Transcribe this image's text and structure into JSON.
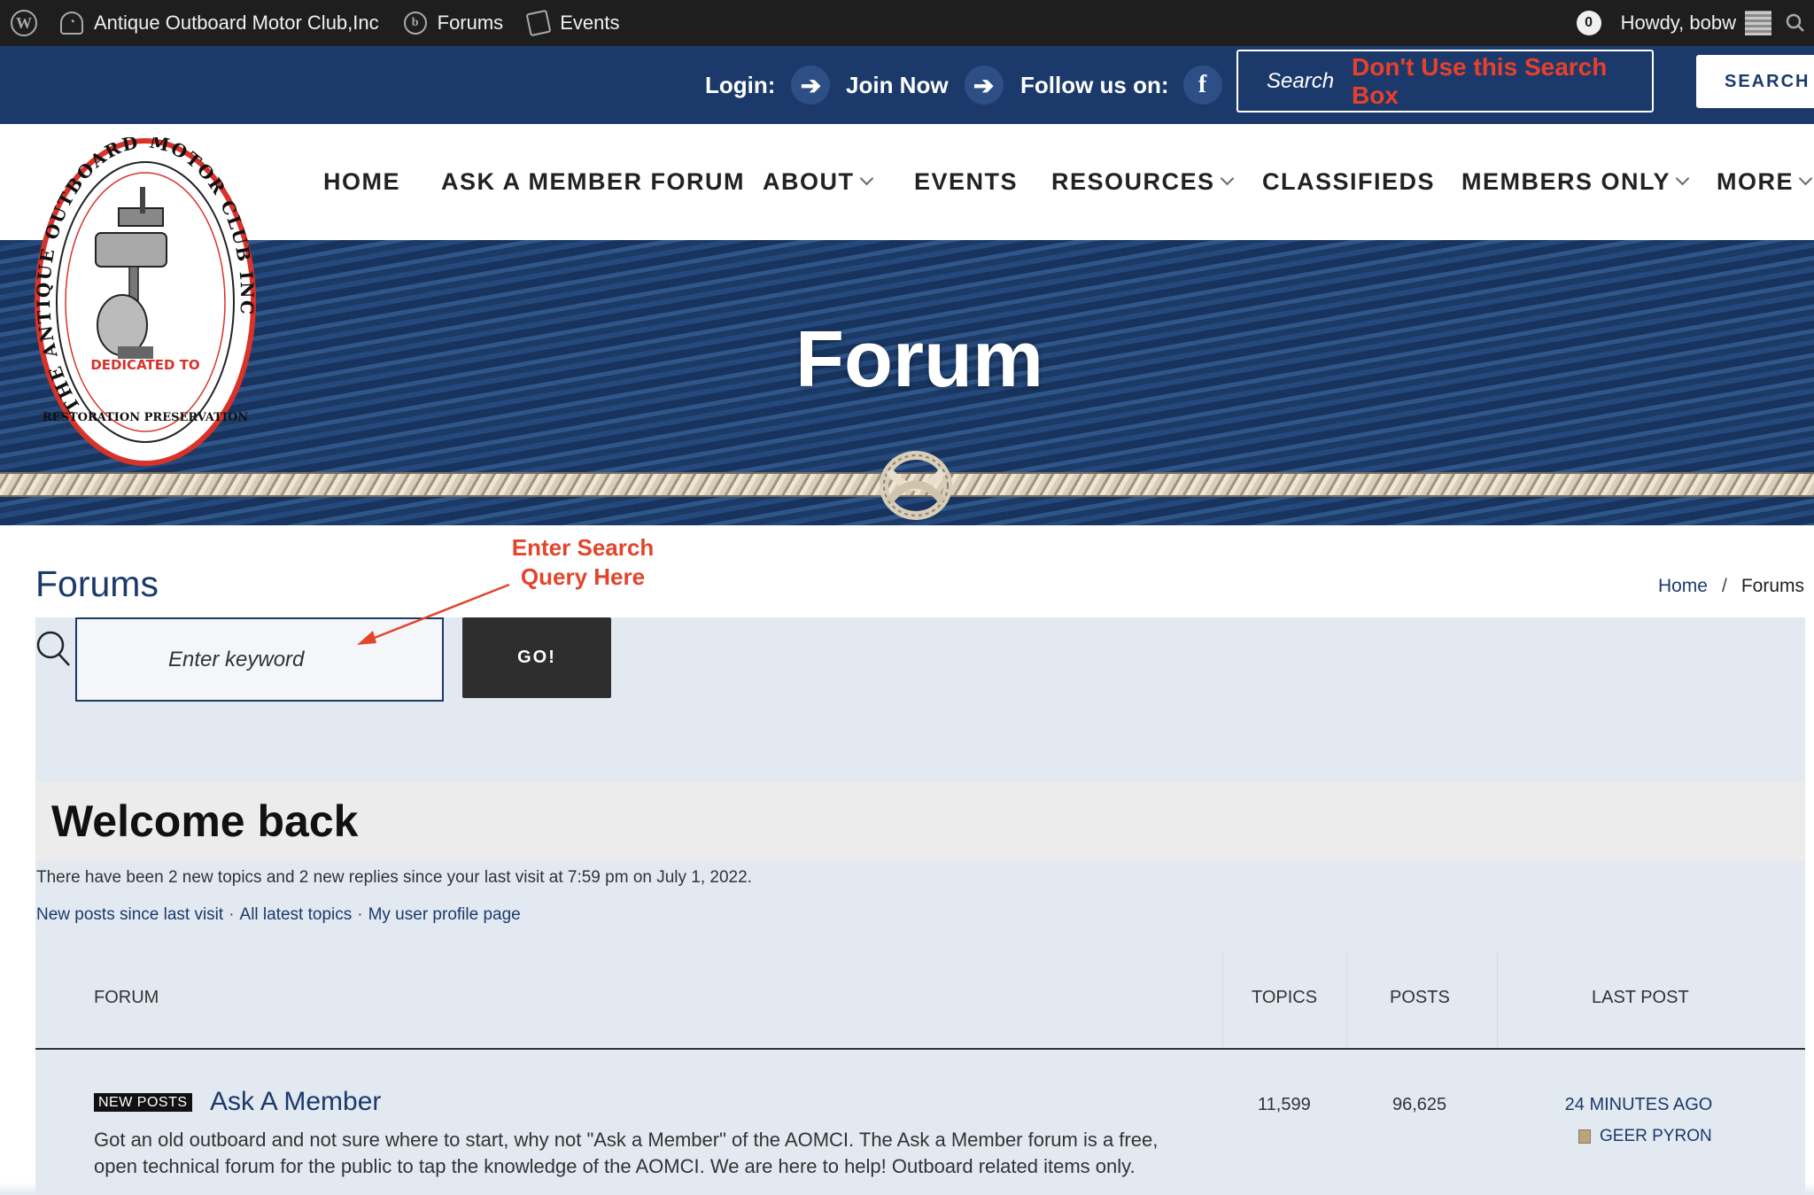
{
  "adminbar": {
    "site_name": "Antique Outboard Motor Club,Inc",
    "forums": "Forums",
    "events": "Events",
    "notification_count": "0",
    "howdy": "Howdy, bobw"
  },
  "topbar": {
    "login": "Login:",
    "join": "Join Now",
    "follow": "Follow us on:",
    "search_placeholder": "Search",
    "search_warning": "Don't Use this Search Box",
    "search_button": "SEARCH"
  },
  "nav": {
    "items": [
      {
        "label": "HOME",
        "dropdown": false
      },
      {
        "label": "ASK A MEMBER FORUM",
        "dropdown": false
      },
      {
        "label": "ABOUT",
        "dropdown": true
      },
      {
        "label": "EVENTS",
        "dropdown": false
      },
      {
        "label": "RESOURCES",
        "dropdown": true
      },
      {
        "label": "CLASSIFIEDS",
        "dropdown": false
      },
      {
        "label": "MEMBERS ONLY",
        "dropdown": true
      },
      {
        "label": "MORE",
        "dropdown": true
      }
    ]
  },
  "logo": {
    "ring_text": "THE ANTIQUE OUTBOARD MOTOR CLUB INC",
    "inner_text": "DEDICATED TO",
    "bottom_text": "RESTORATION PRESERVATION"
  },
  "hero": {
    "title": "Forum"
  },
  "page": {
    "heading": "Forums",
    "breadcrumb_home": "Home",
    "breadcrumb_sep": "/",
    "breadcrumb_current": "Forums",
    "annotation_line1": "Enter Search",
    "annotation_line2": "Query Here",
    "keyword_placeholder": "Enter keyword",
    "go_button": "GO!"
  },
  "welcome": {
    "title": "Welcome back",
    "last_visit": "There have been 2 new topics and 2 new replies since your last visit at 7:59 pm on July 1, 2022.",
    "link_new": "New posts since last visit",
    "link_latest": "All latest topics",
    "link_profile": "My user profile page",
    "link_sep": "·"
  },
  "table": {
    "headers": {
      "forum": "FORUM",
      "topics": "TOPICS",
      "posts": "POSTS",
      "last_post": "LAST POST"
    },
    "rows": [
      {
        "badge": "NEW POSTS",
        "name": "Ask A Member",
        "description": "Got an old outboard and not sure where to start, why not \"Ask a Member\" of the AOMCI.  The Ask a Member forum is a free, open technical forum for the public to tap the knowledge of the AOMCI.  We are here to help!  Outboard related items only.",
        "topics": "11,599",
        "posts": "96,625",
        "last_post_time": "24 MINUTES AGO",
        "last_post_user": "GEER PYRON"
      }
    ]
  },
  "colors": {
    "navy": "#1b3a6b",
    "warning_red": "#e8402a",
    "admin_bar": "#1e1e1e",
    "panel": "#e2e9f1"
  }
}
